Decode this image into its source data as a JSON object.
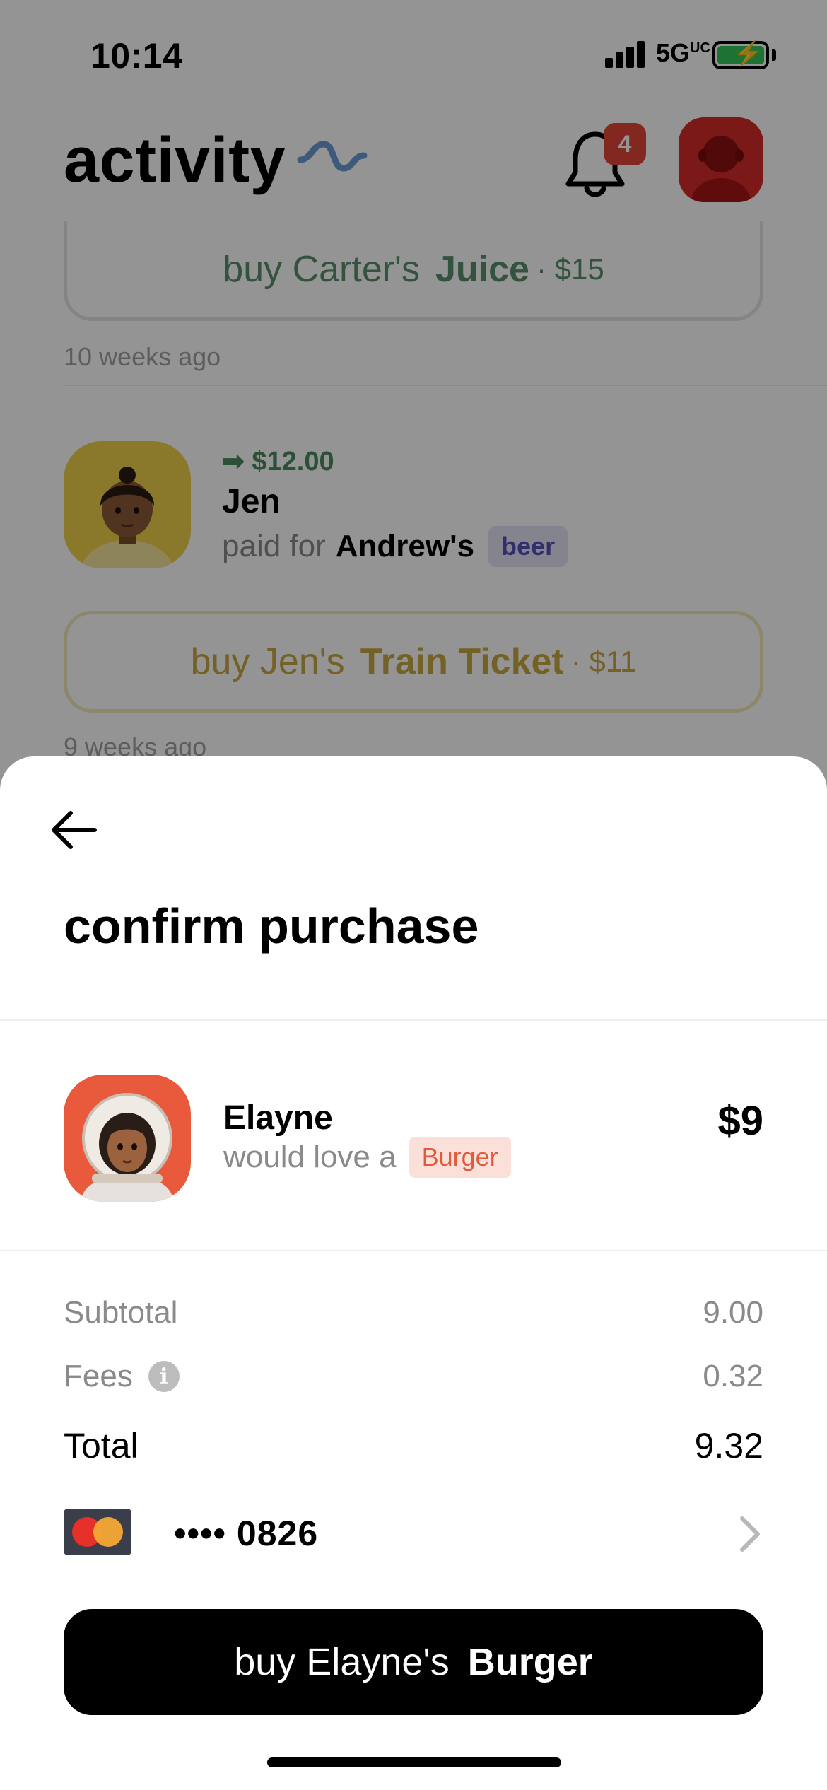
{
  "status_bar": {
    "time": "10:14",
    "network": "5G",
    "network_superscript": "UC"
  },
  "header": {
    "title": "activity",
    "notification_count": "4"
  },
  "activity_feed": {
    "juice_button": {
      "prefix": "buy Carter's",
      "item": "Juice",
      "price": "· $15"
    },
    "juice_time": "10 weeks ago",
    "jen_entry": {
      "amount": "➡ $12.00",
      "name": "Jen",
      "action": "paid for",
      "recipient": "Andrew's",
      "tag": "beer"
    },
    "train_button": {
      "prefix": "buy Jen's",
      "item": "Train Ticket",
      "price": "· $11"
    },
    "train_time": "9 weeks ago"
  },
  "sheet": {
    "title": "confirm purchase",
    "request": {
      "name": "Elayne",
      "action": "would love a",
      "tag": "Burger",
      "price": "$9"
    },
    "summary": {
      "subtotal_label": "Subtotal",
      "subtotal_value": "9.00",
      "fees_label": "Fees",
      "fees_value": "0.32",
      "total_label": "Total",
      "total_value": "9.32"
    },
    "payment": {
      "card_number": "•••• 0826"
    },
    "buy_button": {
      "prefix": "buy Elayne's",
      "item": "Burger"
    }
  },
  "colors": {
    "accent_green": "#4d8a60",
    "accent_gold": "#c8a842",
    "tag_orange": "#e05a3c",
    "tag_purple": "#5550bb",
    "badge_red": "#e0463a",
    "button_black": "#000000"
  }
}
